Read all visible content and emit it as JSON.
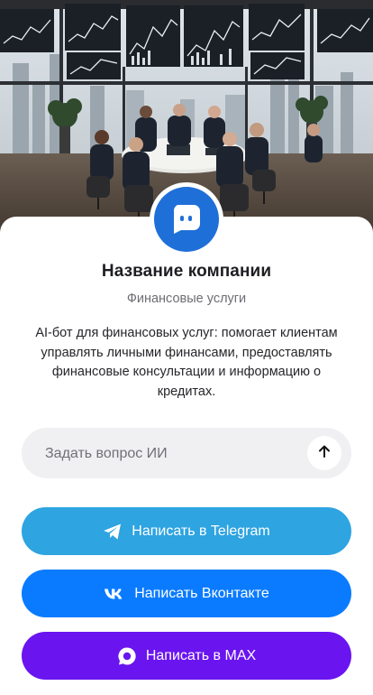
{
  "company": {
    "name": "Название компании",
    "category": "Финансовые услуги",
    "description": "AI-бот для финансовых услуг: помогает клиентам управлять личными финансами, предоставлять финансовые консультации и информацию о кредитах."
  },
  "ask": {
    "placeholder": "Задать вопрос ИИ",
    "value": ""
  },
  "buttons": {
    "telegram": "Написать в Telegram",
    "vk": "Написать Вконтакте",
    "max": "Написать в MAX"
  },
  "colors": {
    "logo": "#1f6fd8",
    "telegram": "#2ea4e1",
    "vk": "#0a7bff",
    "max": "#6a14f0"
  },
  "icons": {
    "logo": "chat-bubble-icon",
    "send": "arrow-up-icon",
    "telegram": "telegram-icon",
    "vk": "vk-icon",
    "max": "max-icon"
  }
}
